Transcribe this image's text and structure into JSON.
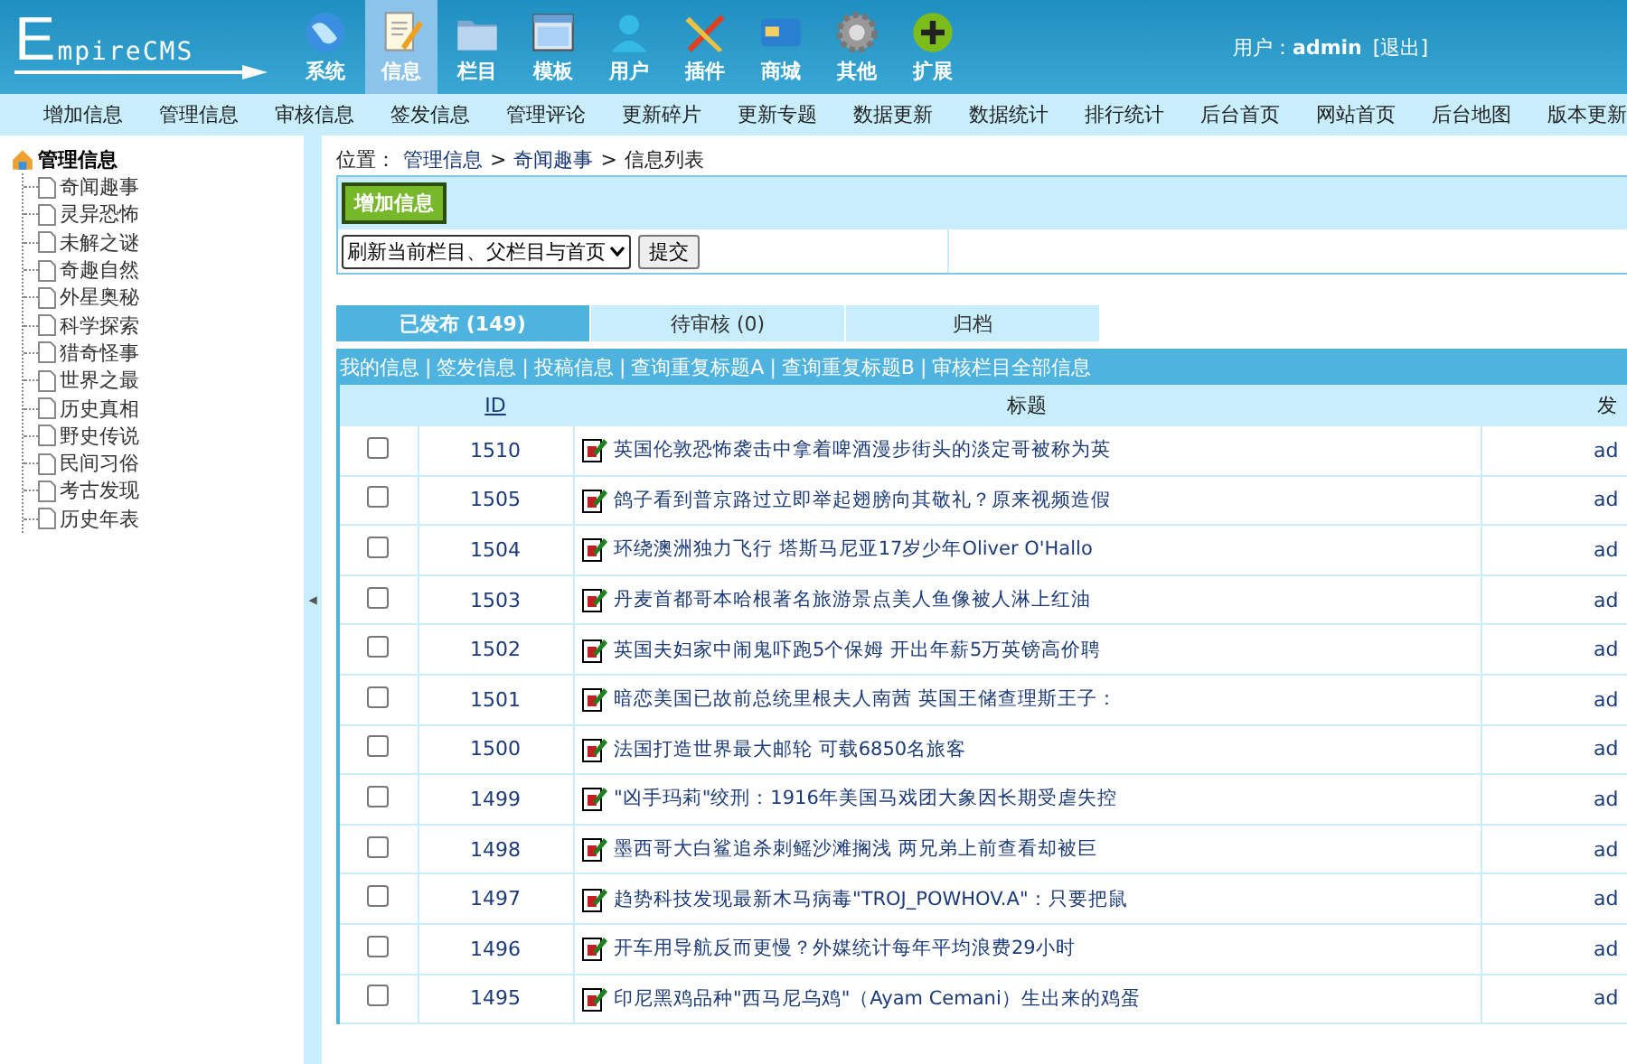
{
  "logo": {
    "text": "EmpireCMS"
  },
  "nav": [
    {
      "label": "系统",
      "selected": false
    },
    {
      "label": "信息",
      "selected": true
    },
    {
      "label": "栏目",
      "selected": false
    },
    {
      "label": "模板",
      "selected": false
    },
    {
      "label": "用户",
      "selected": false
    },
    {
      "label": "插件",
      "selected": false
    },
    {
      "label": "商城",
      "selected": false
    },
    {
      "label": "其他",
      "selected": false
    },
    {
      "label": "扩展",
      "selected": false
    }
  ],
  "user": {
    "label": "用户：",
    "name": "admin",
    "logout": "[退出]"
  },
  "submenu": [
    "增加信息",
    "管理信息",
    "审核信息",
    "签发信息",
    "管理评论",
    "更新碎片",
    "更新专题",
    "数据更新",
    "数据统计",
    "排行统计",
    "后台首页",
    "网站首页",
    "后台地图",
    "版本更新"
  ],
  "sidebar": {
    "root": "管理信息",
    "children": [
      "奇闻趣事",
      "灵异恐怖",
      "未解之谜",
      "奇趣自然",
      "外星奥秘",
      "科学探索",
      "猎奇怪事",
      "世界之最",
      "历史真相",
      "野史传说",
      "民间习俗",
      "考古发现",
      "历史年表"
    ]
  },
  "splitter_arrow": "◀",
  "breadcrumb": {
    "label": "位置：",
    "parts": [
      "管理信息",
      "奇闻趣事",
      "信息列表"
    ],
    "separator": ">"
  },
  "add_button": "增加信息",
  "refresh_select": "刷新当前栏目、父栏目与首页",
  "submit_button": "提交",
  "tabs": [
    {
      "label": "已发布 (149)",
      "selected": true
    },
    {
      "label": "待审核 (0)",
      "selected": false
    },
    {
      "label": "归档",
      "selected": false
    }
  ],
  "link_separator": "|",
  "links": [
    "我的信息",
    "签发信息",
    "投稿信息",
    "查询重复标题A",
    "查询重复标题B",
    "审核栏目全部信息"
  ],
  "table": {
    "columns": [
      "ID",
      "标题",
      "发"
    ],
    "rows": [
      {
        "checked": false,
        "id": "1510",
        "title": "英国伦敦恐怖袭击中拿着啤酒漫步街头的淡定哥被称为英",
        "column_4": "ad"
      },
      {
        "checked": false,
        "id": "1505",
        "title": "鸽子看到普京路过立即举起翅膀向其敬礼？原来视频造假",
        "column_4": "ad"
      },
      {
        "checked": false,
        "id": "1504",
        "title": "环绕澳洲独力飞行 塔斯马尼亚17岁少年Oliver O'Hallo",
        "column_4": "ad"
      },
      {
        "checked": false,
        "id": "1503",
        "title": "丹麦首都哥本哈根著名旅游景点美人鱼像被人淋上红油",
        "column_4": "ad"
      },
      {
        "checked": false,
        "id": "1502",
        "title": "英国夫妇家中闹鬼吓跑5个保姆 开出年薪5万英镑高价聘",
        "column_4": "ad"
      },
      {
        "checked": false,
        "id": "1501",
        "title": "暗恋美国已故前总统里根夫人南茜 英国王储查理斯王子：",
        "column_4": "ad"
      },
      {
        "checked": false,
        "id": "1500",
        "title": "法国打造世界最大邮轮 可载6850名旅客",
        "column_4": "ad"
      },
      {
        "checked": false,
        "id": "1499",
        "title": "\"凶手玛莉\"绞刑：1916年美国马戏团大象因长期受虐失控",
        "column_4": "ad"
      },
      {
        "checked": false,
        "id": "1498",
        "title": "墨西哥大白鲨追杀刺鳐沙滩搁浅 两兄弟上前查看却被巨",
        "column_4": "ad"
      },
      {
        "checked": false,
        "id": "1497",
        "title": "趋势科技发现最新木马病毒\"TROJ_POWHOV.A\"：只要把鼠",
        "column_4": "ad"
      },
      {
        "checked": false,
        "id": "1496",
        "title": "开车用导航反而更慢？外媒统计每年平均浪费29小时",
        "column_4": "ad"
      },
      {
        "checked": false,
        "id": "1495",
        "title": "印尼黑鸡品种\"西马尼乌鸡\"（Ayam Cemani）生出来的鸡蛋",
        "column_4": "ad"
      }
    ]
  }
}
